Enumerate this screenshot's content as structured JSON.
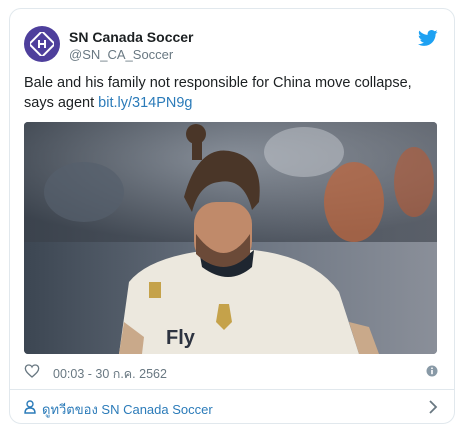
{
  "account": {
    "display_name": "SN Canada Soccer",
    "handle": "@SN_CA_Soccer",
    "avatar_icon": "sn-logo-icon",
    "avatar_color": "#4e3f9c"
  },
  "tweet": {
    "text": "Bale and his family not responsible for China move collapse, says agent ",
    "link": "bit.ly/314PN9g"
  },
  "media": {
    "icon": "photo"
  },
  "meta": {
    "timestamp": "00:03 - 30 ก.ค. 2562",
    "like_icon": "heart-icon",
    "info_icon": "info-icon"
  },
  "footer": {
    "link_label": "ดูทวีตของ SN Canada Soccer"
  },
  "colors": {
    "link": "#2b7bb9",
    "twitter": "#1da1f2",
    "muted": "#697882",
    "border": "#e1e8ed"
  }
}
